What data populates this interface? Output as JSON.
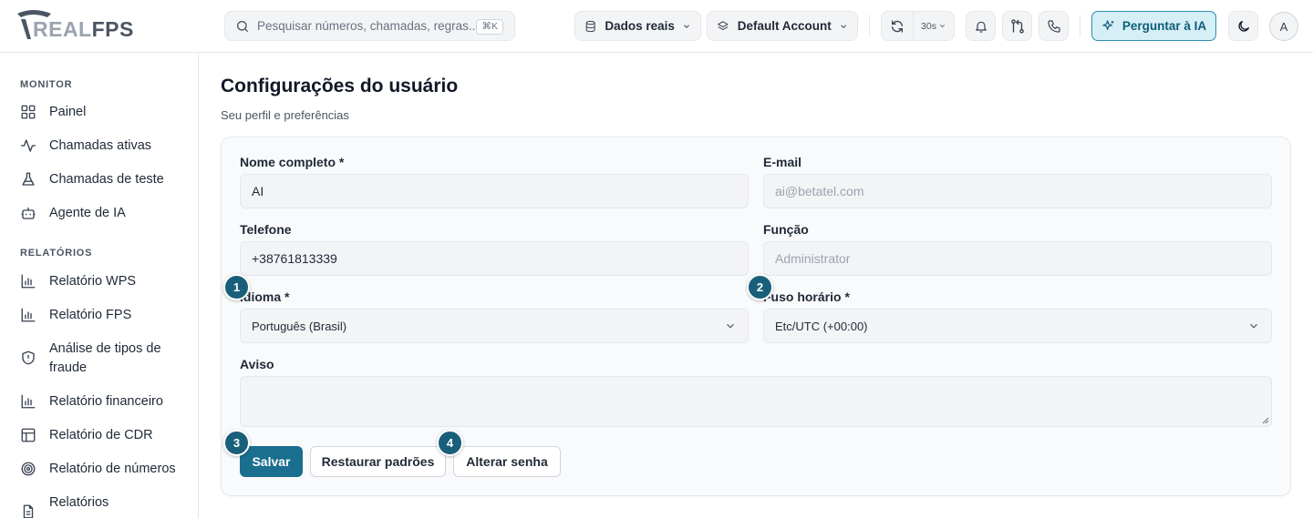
{
  "brand": {
    "logo_part1": "REAL",
    "logo_part2": "FPS"
  },
  "colors": {
    "accent": "#1a6e8e",
    "badge": "#1a5f7a",
    "ai_button_bg": "#d6eef6"
  },
  "search": {
    "placeholder": "Pesquisar números, chamadas, regras...",
    "shortcut": "⌘K",
    "icon": "search-icon"
  },
  "toolbar": {
    "data_source": "Dados reais",
    "account": "Default Account",
    "refresh_interval": "30s",
    "ask_ai": "Perguntar à IA",
    "avatar_initial": "A"
  },
  "sidebar": {
    "sections": [
      {
        "title": "MONITOR",
        "items": [
          {
            "label": "Painel",
            "icon": "grid-icon"
          },
          {
            "label": "Chamadas ativas",
            "icon": "activity-icon"
          },
          {
            "label": "Chamadas de teste",
            "icon": "flask-icon"
          },
          {
            "label": "Agente de IA",
            "icon": "bot-icon"
          }
        ]
      },
      {
        "title": "RELATÓRIOS",
        "items": [
          {
            "label": "Relatório WPS",
            "icon": "bar-chart-icon"
          },
          {
            "label": "Relatório FPS",
            "icon": "bar-chart-icon"
          },
          {
            "label": "Análise de tipos de fraude",
            "icon": "shield-alert-icon"
          },
          {
            "label": "Relatório financeiro",
            "icon": "bar-chart-icon"
          },
          {
            "label": "Relatório de CDR",
            "icon": "table-icon"
          },
          {
            "label": "Relatório de números",
            "icon": "target-icon"
          },
          {
            "label": "Relatórios",
            "icon": "file-text-icon"
          }
        ]
      }
    ]
  },
  "page": {
    "title": "Configurações do usuário",
    "subtitle": "Seu perfil e preferências"
  },
  "form": {
    "full_name": {
      "label": "Nome completo *",
      "value": "AI"
    },
    "email": {
      "label": "E-mail",
      "placeholder": "ai@betatel.com"
    },
    "phone": {
      "label": "Telefone",
      "value": "+38761813339"
    },
    "role": {
      "label": "Função",
      "placeholder": "Administrator"
    },
    "language": {
      "label": "Idioma *",
      "value": "Português (Brasil)"
    },
    "timezone": {
      "label": "Fuso horário *",
      "value": "Etc/UTC (+00:00)"
    },
    "notice": {
      "label": "Aviso",
      "value": ""
    }
  },
  "actions": {
    "save": "Salvar",
    "restore": "Restaurar padrões",
    "change_password": "Alterar senha"
  },
  "badges": [
    "1",
    "2",
    "3",
    "4"
  ]
}
